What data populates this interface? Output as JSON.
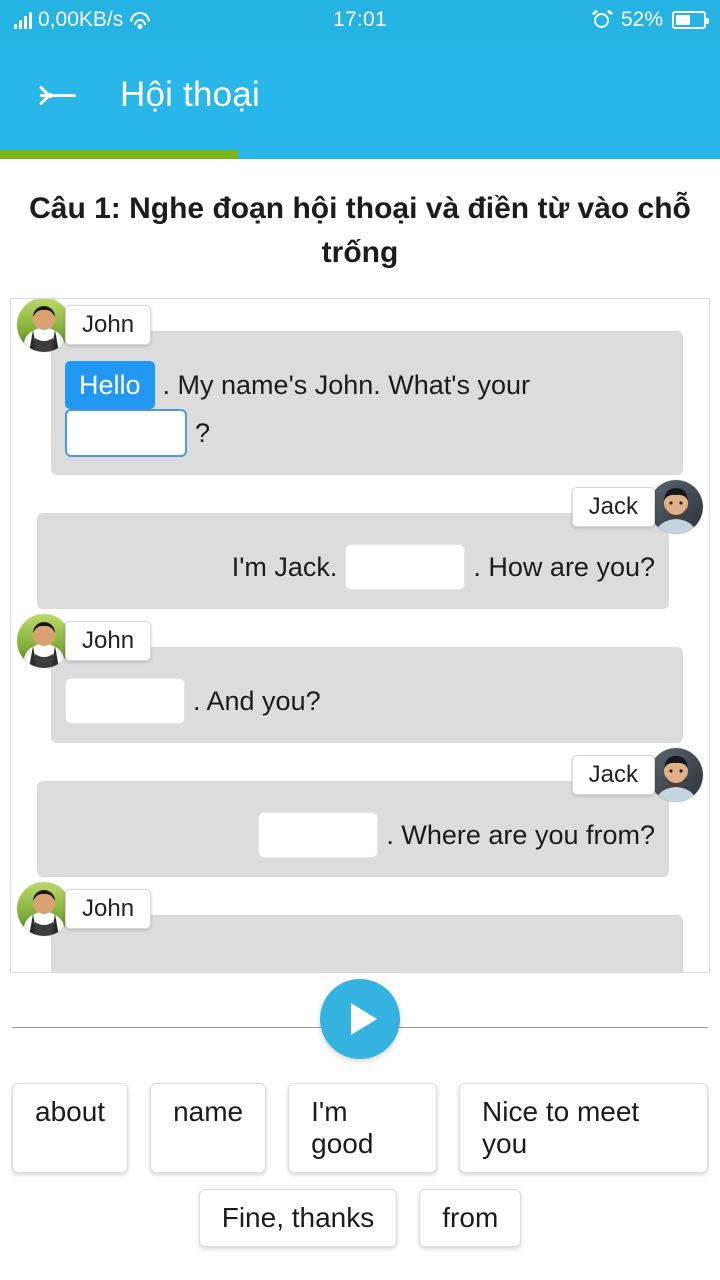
{
  "status_bar": {
    "network_speed": "0,00KB/s",
    "time": "17:01",
    "battery_percent": "52%",
    "battery_level": 52,
    "icons": [
      "signal-icon",
      "wifi-icon",
      "alarm-icon",
      "battery-icon"
    ]
  },
  "app_bar": {
    "back_label": "back-arrow-icon",
    "title": "Hội thoại",
    "background": "#29b6e8"
  },
  "progress": {
    "percent": 33,
    "fill_color": "#7cb518",
    "track_color": "#29b6e8"
  },
  "question": {
    "text": "Câu 1: Nghe đoạn hội thoại và điền từ vào chỗ trống"
  },
  "conversation": {
    "messages": [
      {
        "speaker": "John",
        "side": "left",
        "avatar": "john-avatar",
        "parts": [
          [
            {
              "type": "filled",
              "value": "Hello"
            },
            {
              "type": "text",
              "value": ". My name's John. What's your"
            }
          ],
          [
            {
              "type": "blank",
              "value": "",
              "active": true
            },
            {
              "type": "text",
              "value": "?"
            }
          ]
        ]
      },
      {
        "speaker": "Jack",
        "side": "right",
        "avatar": "jack-avatar",
        "parts": [
          [
            {
              "type": "text",
              "value": "I'm Jack."
            },
            {
              "type": "blank",
              "value": "",
              "active": false
            },
            {
              "type": "text",
              "value": ". How are you?"
            }
          ]
        ]
      },
      {
        "speaker": "John",
        "side": "left",
        "avatar": "john-avatar",
        "parts": [
          [
            {
              "type": "blank",
              "value": "",
              "active": false
            },
            {
              "type": "text",
              "value": ". And you?"
            }
          ]
        ]
      },
      {
        "speaker": "Jack",
        "side": "right",
        "avatar": "jack-avatar",
        "parts": [
          [
            {
              "type": "blank",
              "value": "",
              "active": false
            },
            {
              "type": "text",
              "value": ". Where are you from?"
            }
          ]
        ]
      },
      {
        "speaker": "John",
        "side": "left",
        "avatar": "john-avatar",
        "parts": []
      }
    ]
  },
  "audio": {
    "play_icon": "play-icon",
    "button_color": "#34b3e0"
  },
  "word_bank": {
    "rows": [
      [
        "about",
        "name",
        "I'm good",
        "Nice to meet you"
      ],
      [
        "Fine, thanks",
        "from"
      ]
    ]
  },
  "colors": {
    "accent": "#29b6e8",
    "chip_filled": "#2196f3",
    "bubble": "#dcdcdc",
    "blank_active_border": "#4f9bd0"
  }
}
